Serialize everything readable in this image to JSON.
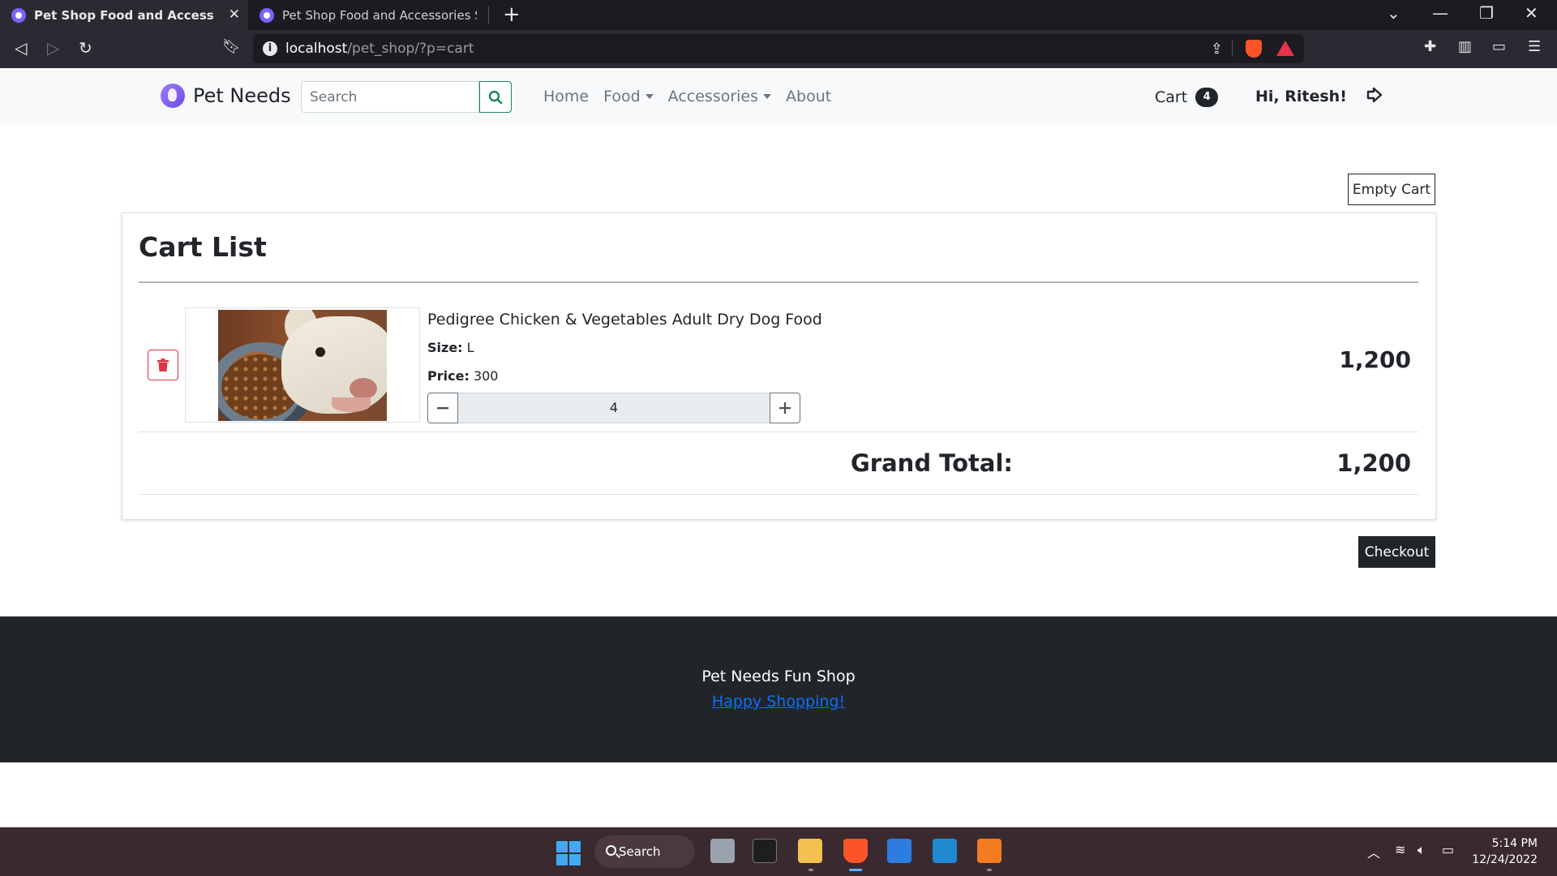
{
  "browser": {
    "tabs": [
      {
        "title": "Pet Shop Food and Accessories Sh",
        "active": true
      },
      {
        "title": "Pet Shop Food and Accessories Shop",
        "active": false
      }
    ],
    "url_host": "localhost",
    "url_path": "/pet_shop/?p=cart"
  },
  "site": {
    "brand": "Pet Needs",
    "search_placeholder": "Search",
    "nav": {
      "home": "Home",
      "food": "Food",
      "accessories": "Accessories",
      "about": "About"
    },
    "cart_label": "Cart",
    "cart_count": "4",
    "greeting": "Hi, Ritesh!"
  },
  "cart": {
    "empty_button": "Empty Cart",
    "title": "Cart List",
    "items": [
      {
        "name": "Pedigree Chicken & Vegetables Adult Dry Dog Food",
        "size_label": "Size:",
        "size": "L",
        "price_label": "Price:",
        "price": "300",
        "quantity": "4",
        "line_total": "1,200"
      }
    ],
    "grand_total_label": "Grand Total:",
    "grand_total": "1,200",
    "checkout_button": "Checkout"
  },
  "footer": {
    "title": "Pet Needs Fun Shop",
    "link": "Happy Shopping!"
  },
  "taskbar": {
    "search_label": "Search",
    "time": "5:14 PM",
    "date": "12/24/2022"
  },
  "colors": {
    "accent_green": "#198754",
    "danger_red": "#dc3545",
    "dark": "#212529",
    "link_blue": "#0d6efd"
  }
}
